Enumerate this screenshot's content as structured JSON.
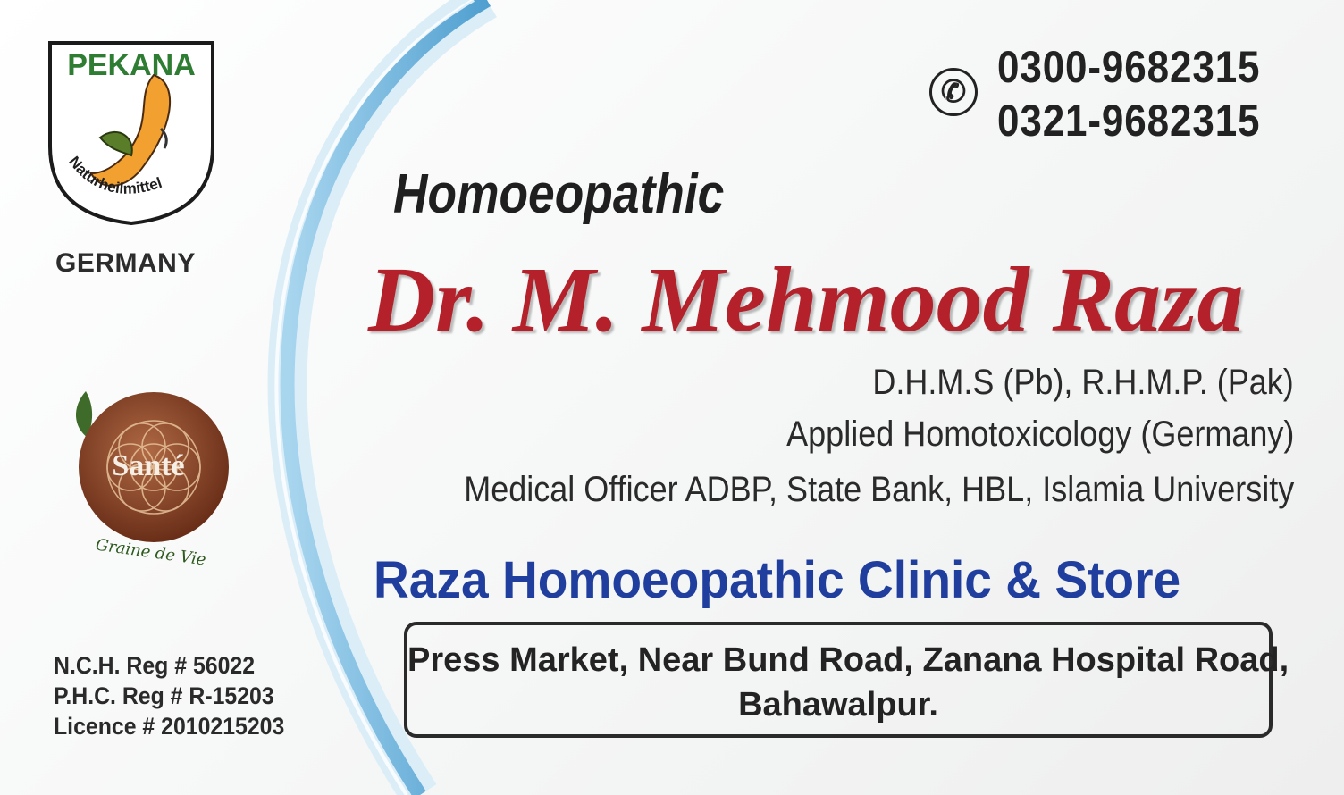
{
  "logo_pekana": {
    "brand": "PEKANA",
    "tagline": "Naturheilmittel",
    "country": "GERMANY"
  },
  "logo_sante": {
    "brand": "Santé",
    "tagline": "Graine de Vie"
  },
  "registration": {
    "nch": "N.C.H. Reg # 56022",
    "phc": "P.H.C. Reg # R-15203",
    "licence": "Licence # 2010215203"
  },
  "contact": {
    "phone_1": "0300-9682315",
    "phone_2": "0321-9682315",
    "icon": "phone-icon"
  },
  "header": {
    "specialty": "Homoeopathic",
    "name": "Dr. M. Mehmood Raza"
  },
  "qualifications": [
    "D.H.M.S (Pb), R.H.M.P. (Pak)",
    "Applied Homotoxicology (Germany)",
    "Medical Officer ADBP, State Bank, HBL, Islamia University"
  ],
  "clinic": {
    "name": "Raza Homoeopathic Clinic & Store",
    "address_line_1": "Press Market, Near Bund Road, Zanana Hospital Road,",
    "address_line_2": "Bahawalpur."
  },
  "colors": {
    "name": "#b4212a",
    "clinic": "#1f3e9e",
    "arc": "#6fb6de"
  }
}
